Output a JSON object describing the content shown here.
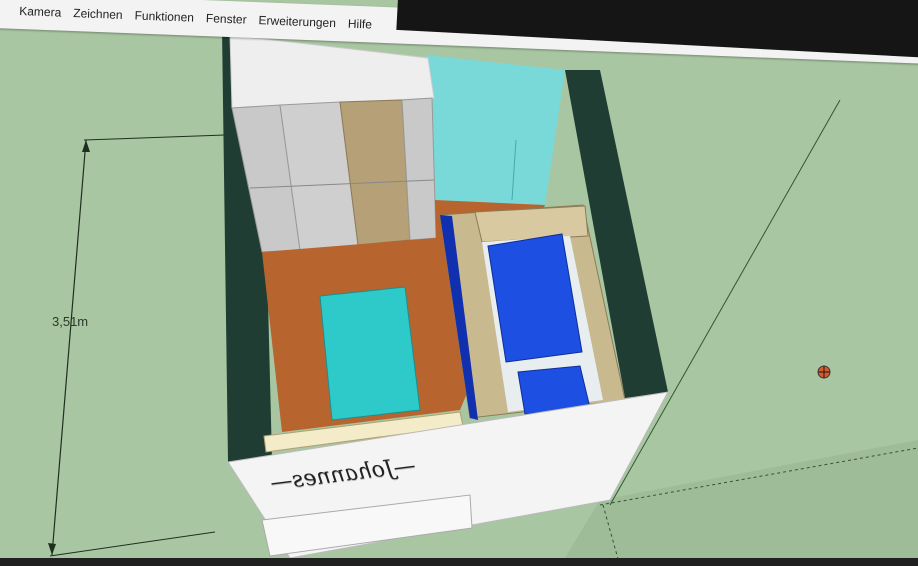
{
  "menu": {
    "items": [
      "Kamera",
      "Zeichnen",
      "Funktionen",
      "Fenster",
      "Erweiterungen",
      "Hilfe"
    ]
  },
  "viewport": {
    "dimension_label": "3,51m",
    "wall_text": "—Johannes—"
  },
  "colors": {
    "ground": "#a7c4a0",
    "floor": "#b8642e",
    "rug": "#2ec9c9",
    "bed_cover": "#1d4fe3",
    "wall": "#f3f3f3",
    "wood": "#c9b98f"
  },
  "icons": [
    "axis-origin-icon"
  ]
}
